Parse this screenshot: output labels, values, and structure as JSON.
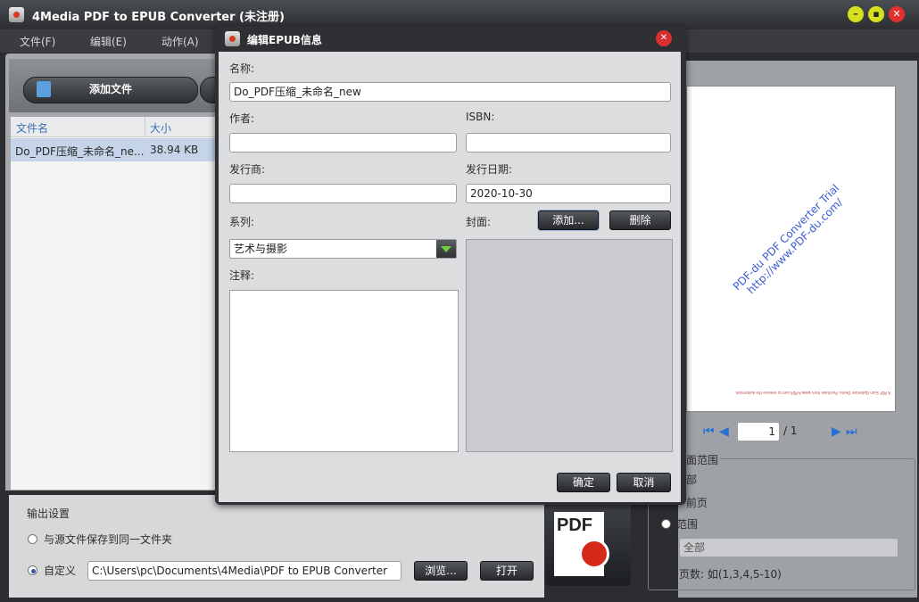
{
  "window": {
    "title": "4Media PDF to EPUB Converter (未注册)"
  },
  "menu": [
    "文件(F)",
    "编辑(E)",
    "动作(A)"
  ],
  "toolbar": {
    "add_file": "添加文件"
  },
  "filelist": {
    "headers": [
      "文件名",
      "大小"
    ],
    "rows": [
      {
        "name": "Do_PDF压缩_未命名_ne...",
        "size": "38.94 KB"
      }
    ]
  },
  "output": {
    "title": "输出设置",
    "option_same": "与源文件保存到同一文件夹",
    "option_custom": "自定义",
    "path": "C:\\Users\\pc\\Documents\\4Media\\PDF to EPUB Converter",
    "browse": "浏览...",
    "open": "打开"
  },
  "preview": {
    "watermark": "PDF-du PDF Converter Trial\nhttp://www.PDF-du.com/",
    "page_current": "1",
    "page_total": "/ 1",
    "footer_note": "A PDF Scan Optimizer Demo. Purchase from www.A-PDF.com to remove the watermark"
  },
  "page_range": {
    "title": "面范围",
    "all": "部",
    "current": "前页",
    "range": "范围",
    "range_value": "全部",
    "hint": "页数: 如(1,3,4,5-10)"
  },
  "dialog": {
    "title": "编辑EPUB信息",
    "name_label": "名称:",
    "name_value": "Do_PDF压缩_未命名_new",
    "author_label": "作者:",
    "author_value": "",
    "isbn_label": "ISBN:",
    "isbn_value": "",
    "publisher_label": "发行商:",
    "publisher_value": "",
    "date_label": "发行日期:",
    "date_value": "2020-10-30",
    "series_label": "系列:",
    "series_value": "艺术与摄影",
    "cover_label": "封面:",
    "cover_add": "添加...",
    "cover_delete": "删除",
    "notes_label": "注释:",
    "ok": "确定",
    "cancel": "取消"
  },
  "colors": {
    "accent": "#3e6fb5",
    "selection": "#c5d4e9"
  }
}
